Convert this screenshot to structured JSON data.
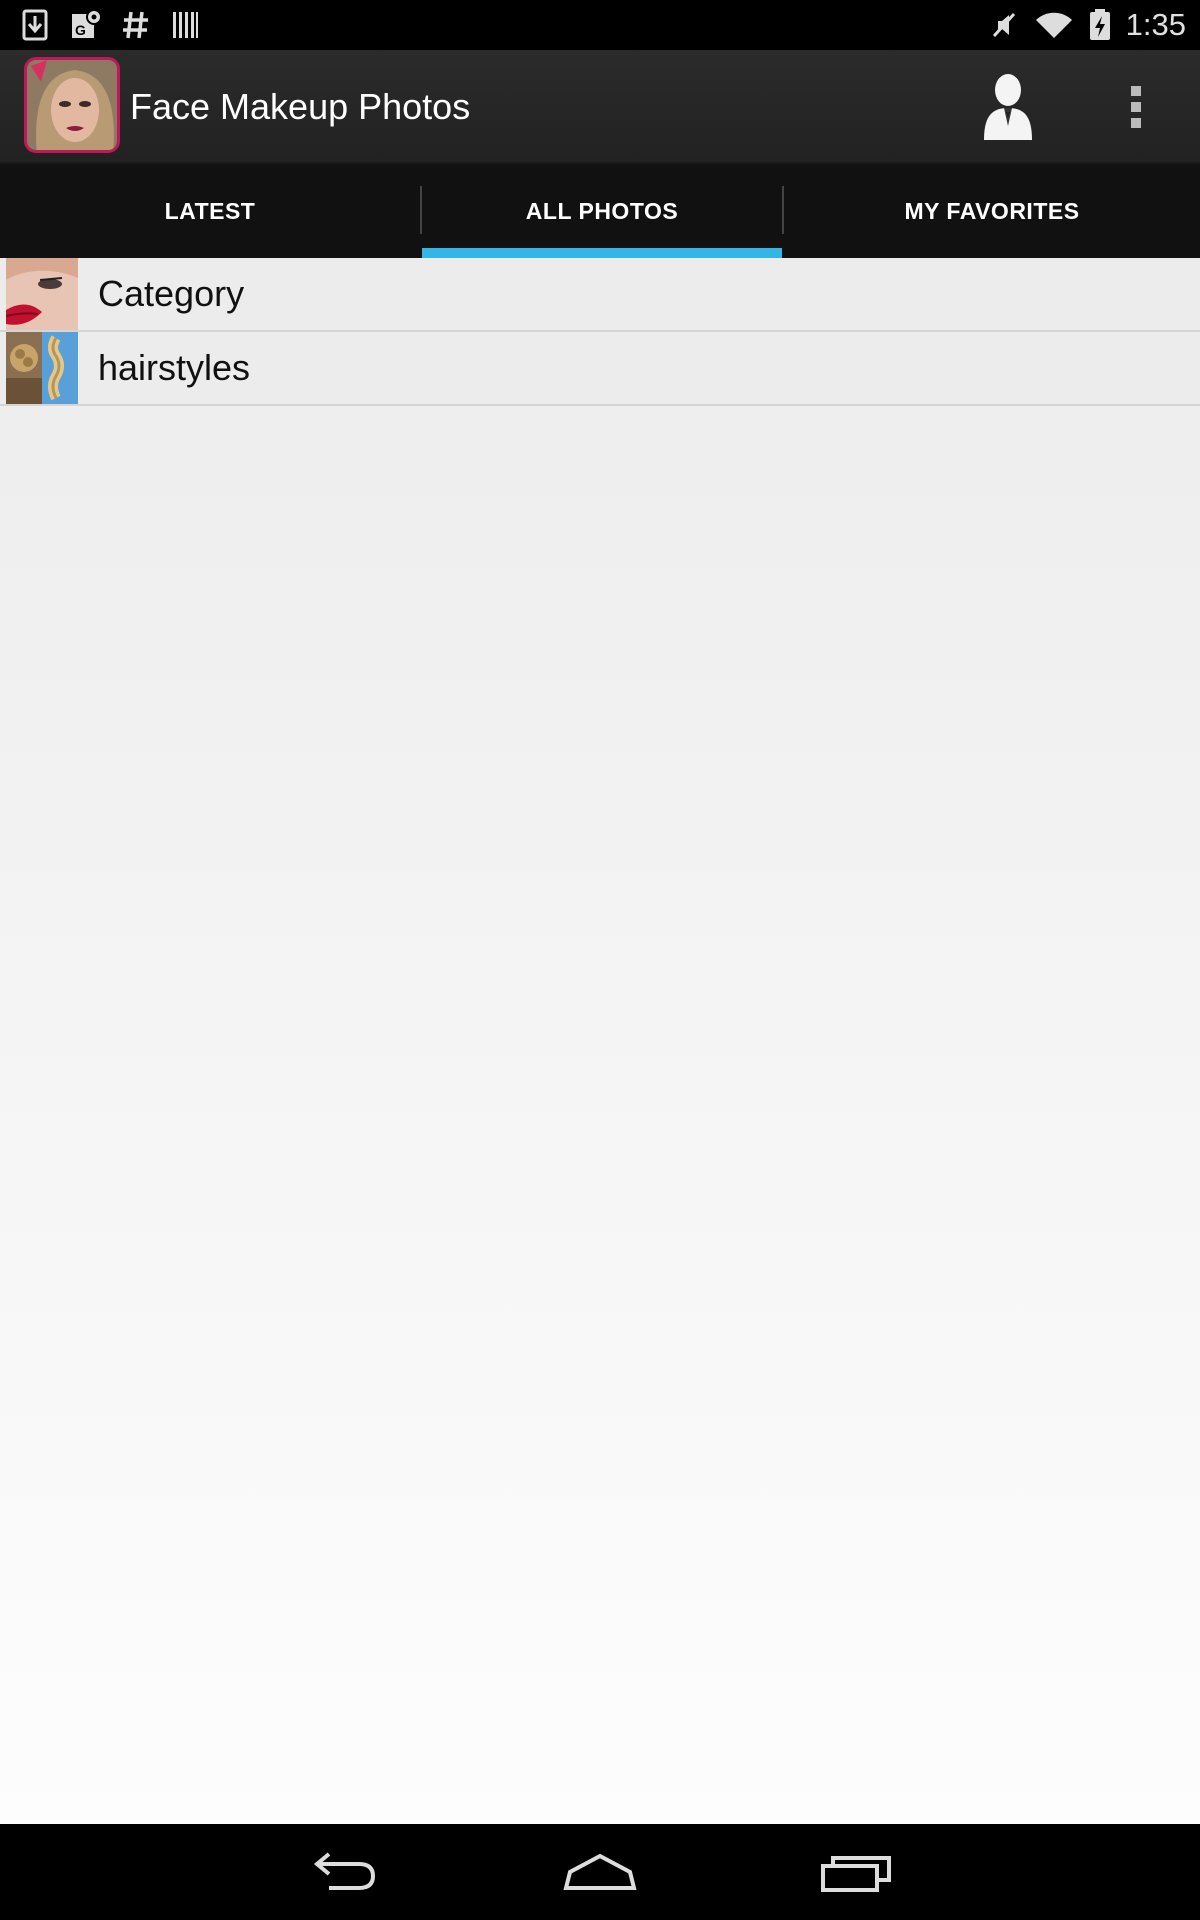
{
  "status_bar": {
    "time": "1:35",
    "left_icons": [
      "download-icon",
      "maps-icon",
      "hashtag-icon",
      "barcode-icon"
    ],
    "right_icons": [
      "mute-icon",
      "wifi-icon",
      "battery-charging-icon"
    ]
  },
  "action_bar": {
    "title": "Face Makeup Photos",
    "actions": [
      "person-icon",
      "overflow-menu-icon"
    ]
  },
  "tabs": [
    {
      "label": "LATEST",
      "selected": false
    },
    {
      "label": "ALL PHOTOS",
      "selected": true
    },
    {
      "label": "MY FAVORITES",
      "selected": false
    }
  ],
  "list": {
    "items": [
      {
        "label": "Category",
        "thumbnail": "lips-makeup-thumbnail"
      },
      {
        "label": "hairstyles",
        "thumbnail": "braids-hairstyle-thumbnail"
      }
    ]
  },
  "nav_bar": {
    "buttons": [
      "back-icon",
      "home-icon",
      "recents-icon"
    ]
  },
  "colors": {
    "accent": "#33b5e5",
    "app_icon_border": "#c2185b",
    "tab_background": "#111111",
    "action_bar": "#2b2b2b"
  }
}
